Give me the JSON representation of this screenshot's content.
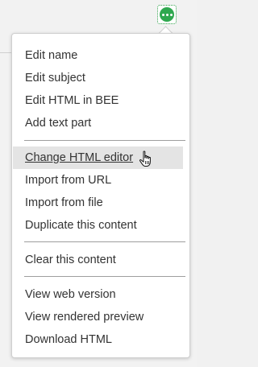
{
  "menu": {
    "groups": [
      [
        "Edit name",
        "Edit subject",
        "Edit HTML in BEE",
        "Add text part"
      ],
      [
        "Change HTML editor",
        "Import from URL",
        "Import from file",
        "Duplicate this content"
      ],
      [
        "Clear this content"
      ],
      [
        "View web version",
        "View rendered preview",
        "Download HTML"
      ]
    ],
    "hovered_item": "Change HTML editor"
  },
  "icons": {
    "more": "more-horizontal-icon",
    "cursor": "hand-pointer-cursor-icon"
  },
  "colors": {
    "accent_green": "#2fa84f",
    "menu_background": "#ffffff",
    "hover_background": "#e4e4e4",
    "text": "#333333"
  }
}
